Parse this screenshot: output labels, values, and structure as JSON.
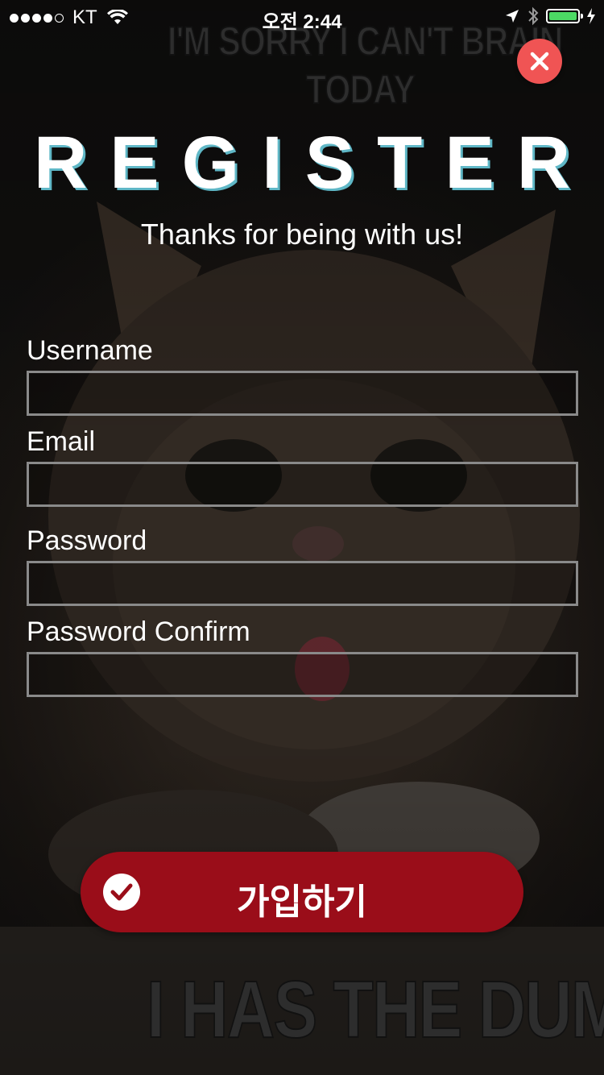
{
  "status_bar": {
    "carrier": "KT",
    "time": "오전 2:44"
  },
  "background": {
    "meme_top_line1": "I'M SORRY I CAN'T BRAIN",
    "meme_top_line2": "TODAY",
    "meme_bottom": "I HAS THE DUMB"
  },
  "header": {
    "title": "REGISTER",
    "subtitle": "Thanks for being with us!"
  },
  "form": {
    "fields": [
      {
        "label": "Username",
        "value": ""
      },
      {
        "label": "Email",
        "value": ""
      },
      {
        "label": "Password",
        "value": ""
      },
      {
        "label": "Password Confirm",
        "value": ""
      }
    ],
    "submit_label": "가입하기"
  },
  "colors": {
    "close_button": "#f05454",
    "submit_button": "#9a0d19",
    "title_shadow": "#5fb7c6",
    "battery": "#4cd964"
  },
  "icons": {
    "close": "close-icon",
    "submit": "check-icon"
  }
}
